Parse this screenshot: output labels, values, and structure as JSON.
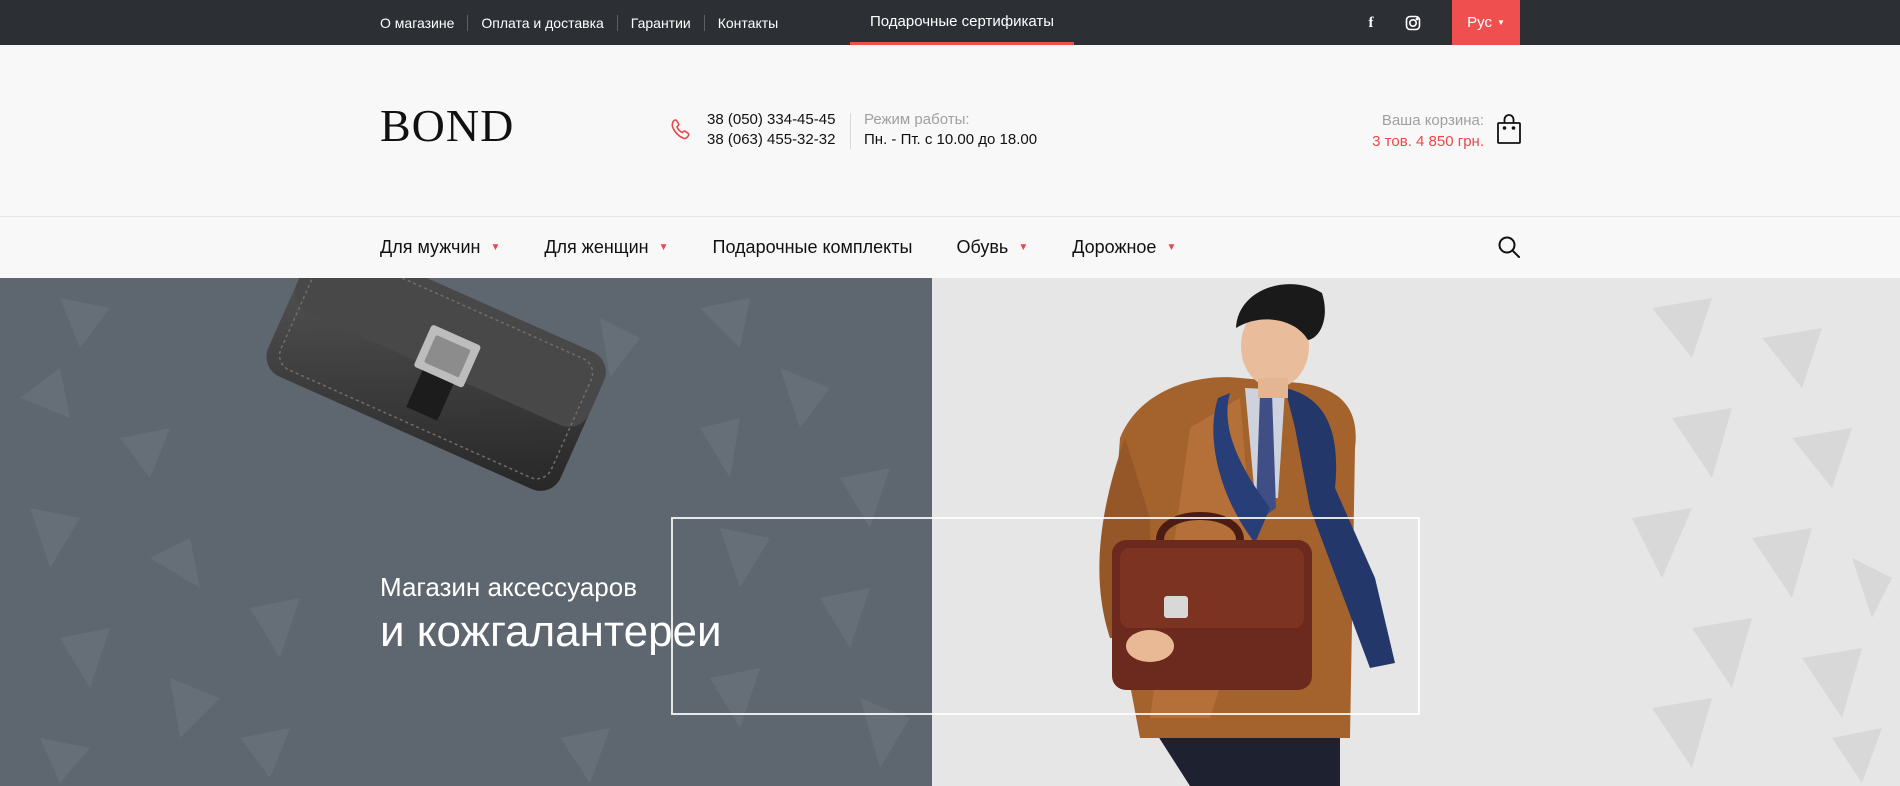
{
  "topbar": {
    "links": [
      "О магазине",
      "Оплата и доставка",
      "Гарантии",
      "Контакты"
    ],
    "gift_certificates": "Подарочные сертификаты",
    "social": [
      "facebook-icon",
      "instagram-icon"
    ],
    "language": "Рус"
  },
  "header": {
    "logo": "BOND",
    "phones": [
      "38 (050) 334-45-45",
      "38 (063) 455-32-32"
    ],
    "hours_label": "Режим работы:",
    "hours_value": "Пн. - Пт. с 10.00 до 18.00",
    "cart_label": "Ваша корзина:",
    "cart_value": "3 тов. 4 850 грн."
  },
  "nav": {
    "items": [
      {
        "label": "Для мужчин",
        "has_dropdown": true
      },
      {
        "label": "Для женщин",
        "has_dropdown": true
      },
      {
        "label": "Подарочные комплекты",
        "has_dropdown": false
      },
      {
        "label": "Обувь",
        "has_dropdown": true
      },
      {
        "label": "Дорожное",
        "has_dropdown": true
      }
    ]
  },
  "hero": {
    "subtitle": "Магазин аксессуаров",
    "title": "и кожгалантереи"
  },
  "colors": {
    "accent": "#ef4f4f",
    "topbar_bg": "#2c2f34",
    "hero_left_bg": "#5e6670",
    "hero_right_bg": "#e7e6e6"
  }
}
